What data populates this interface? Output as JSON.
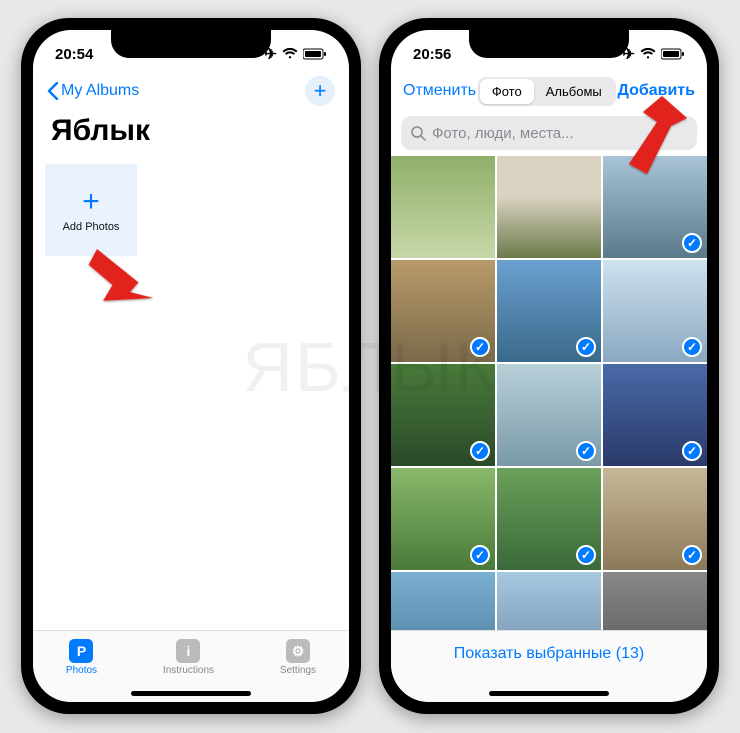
{
  "left": {
    "status_time": "20:54",
    "nav_back": "My Albums",
    "album_title": "Яблык",
    "add_tile_label": "Add Photos",
    "tabs": [
      {
        "label": "Photos",
        "icon": "P",
        "active": true
      },
      {
        "label": "Instructions",
        "icon": "i",
        "active": false
      },
      {
        "label": "Settings",
        "icon": "⚙",
        "active": false
      }
    ]
  },
  "right": {
    "status_time": "20:56",
    "cancel": "Отменить",
    "seg_photos": "Фото",
    "seg_albums": "Альбомы",
    "add": "Добавить",
    "search_placeholder": "Фото, люди, места...",
    "selected_count": 13,
    "show_selected_label": "Показать выбранные (13)",
    "thumbs": [
      {
        "selected": false,
        "cls": "g1"
      },
      {
        "selected": false,
        "cls": "g2"
      },
      {
        "selected": true,
        "cls": "g3"
      },
      {
        "selected": true,
        "cls": "g4"
      },
      {
        "selected": true,
        "cls": "g5"
      },
      {
        "selected": true,
        "cls": "g6"
      },
      {
        "selected": true,
        "cls": "g7"
      },
      {
        "selected": true,
        "cls": "g8"
      },
      {
        "selected": true,
        "cls": "g9"
      },
      {
        "selected": true,
        "cls": "g10"
      },
      {
        "selected": true,
        "cls": "g11"
      },
      {
        "selected": true,
        "cls": "g12"
      },
      {
        "selected": true,
        "cls": "g13"
      },
      {
        "selected": true,
        "cls": "g14"
      },
      {
        "selected": true,
        "cls": "g15"
      }
    ]
  },
  "watermark": "ЯБЛЫК"
}
